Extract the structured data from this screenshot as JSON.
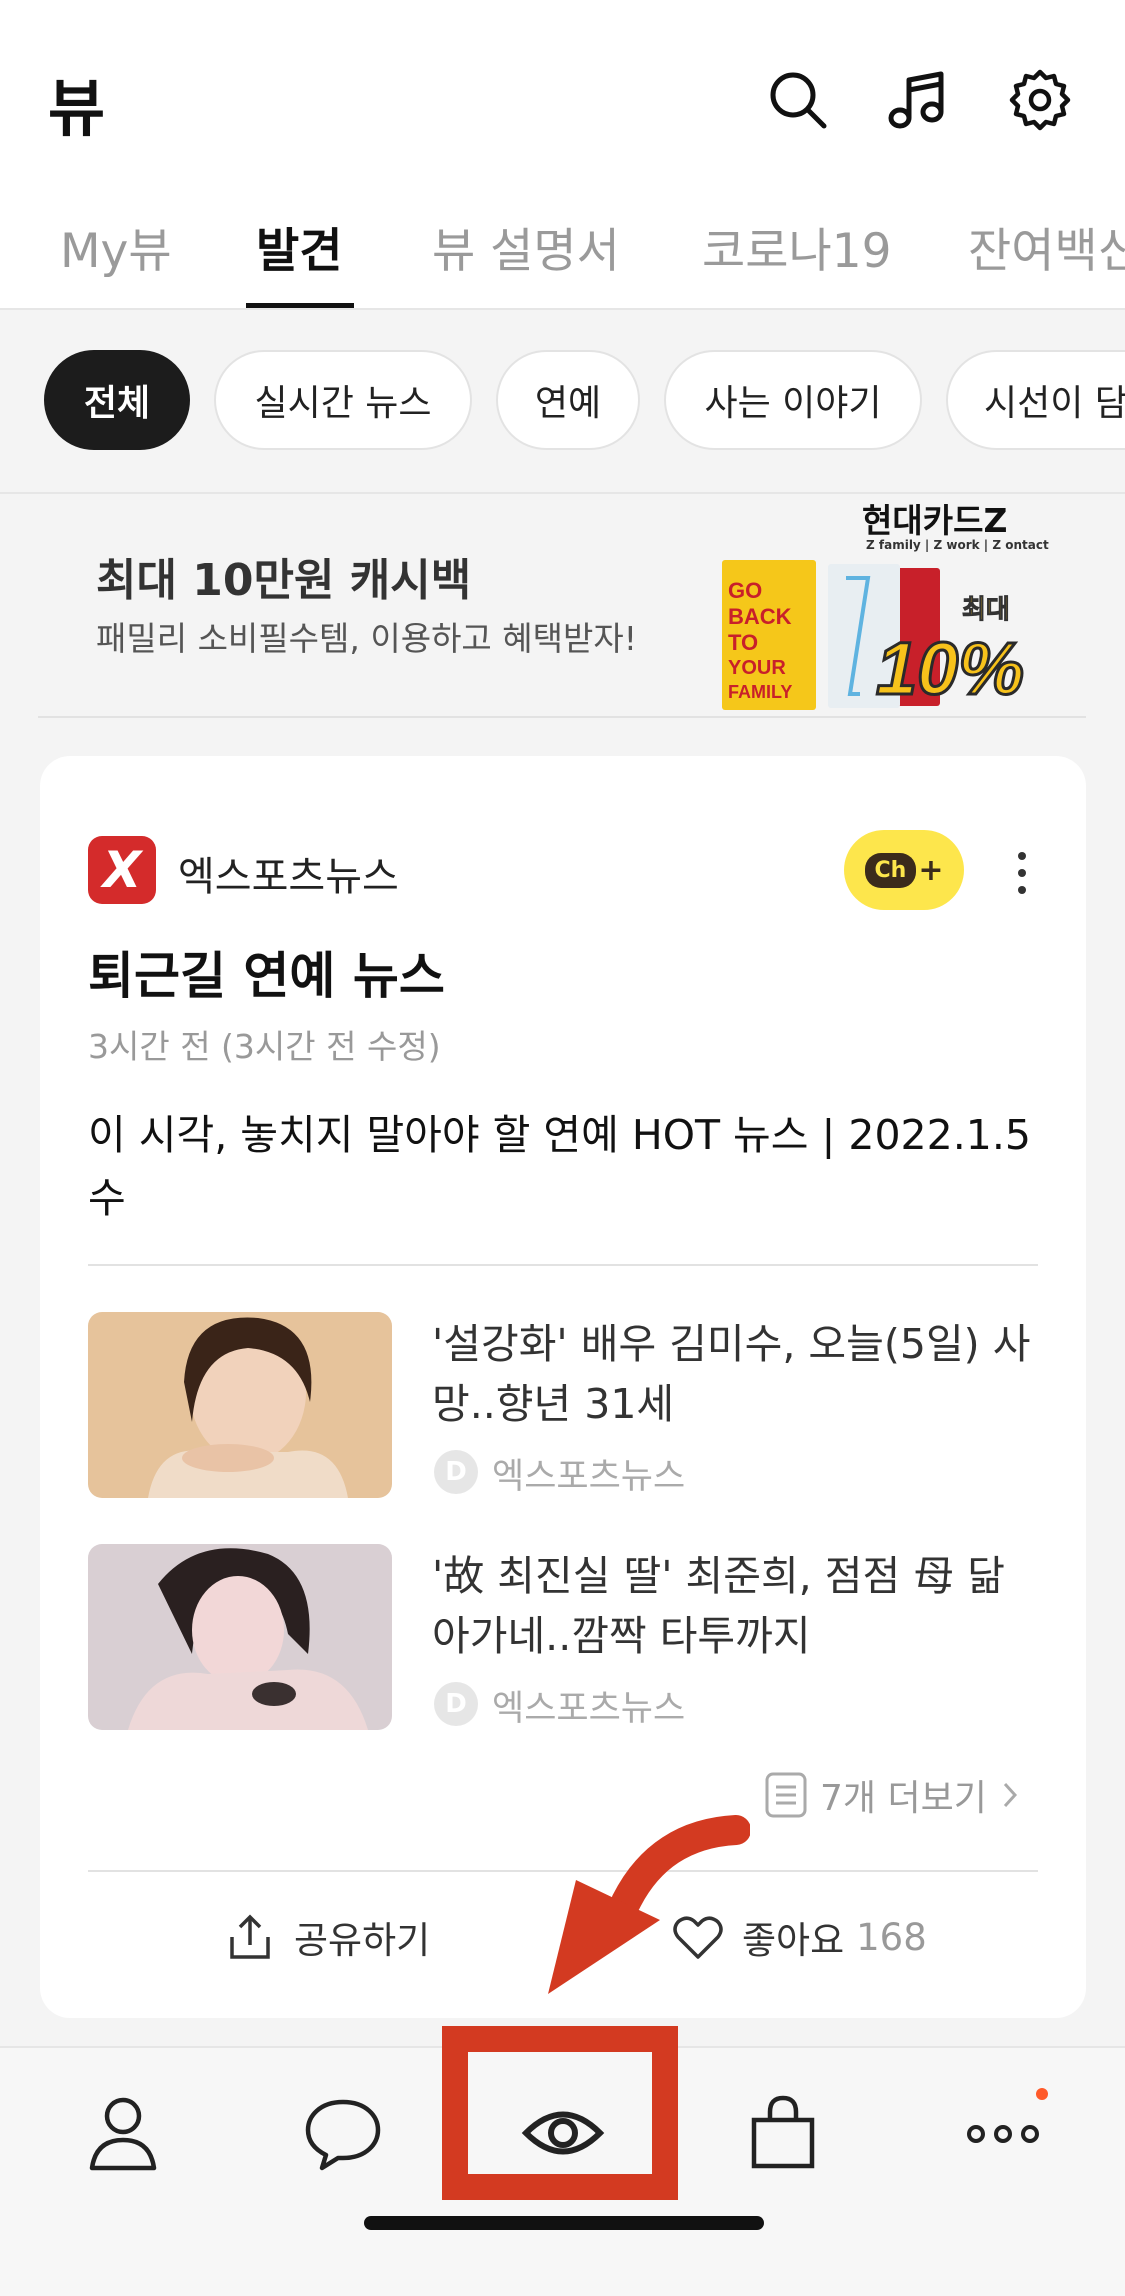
{
  "header": {
    "title": "뷰",
    "icons": [
      "search-icon",
      "music-icon",
      "settings-icon"
    ]
  },
  "tabs": [
    {
      "label": "My뷰",
      "active": false
    },
    {
      "label": "발견",
      "active": true
    },
    {
      "label": "뷰 설명서",
      "active": false
    },
    {
      "label": "코로나19",
      "active": false
    },
    {
      "label": "잔여백신",
      "active": false
    }
  ],
  "chips": [
    {
      "label": "전체",
      "active": true
    },
    {
      "label": "실시간 뉴스",
      "active": false
    },
    {
      "label": "연예",
      "active": false
    },
    {
      "label": "사는 이야기",
      "active": false
    },
    {
      "label": "시선이 담",
      "active": false
    }
  ],
  "ad": {
    "title": "최대 10만원 캐시백",
    "subtitle": "패밀리 소비필수템, 이용하고 혜택받자!",
    "brand": "현대카드Z",
    "brand_sub": "Z family | Z work | Z ontact",
    "card_text": [
      "GO",
      "BACK",
      "TO",
      "YOUR",
      "FAMILY"
    ],
    "badge_top": "최대",
    "badge_main": "10%",
    "colors": {
      "yellow_card": "#f5c71a",
      "red_card": "#c8202a",
      "badge": "#f7c21b"
    }
  },
  "card": {
    "publisher": "엑스포츠뉴스",
    "publisher_logo": "X",
    "channel_button": {
      "label": "Ch",
      "plus": "+"
    },
    "title": "퇴근길 연예 뉴스",
    "time": "3시간 전 (3시간 전 수정)",
    "description": "이 시각, 놓치지 말아야 할 연예 HOT 뉴스 | 2022.1.5 수",
    "news": [
      {
        "headline": "'설강화' 배우 김미수, 오늘(5일) 사망..향년 31세",
        "source": "엑스포츠뉴스",
        "source_icon": "D"
      },
      {
        "headline": "'故 최진실 딸' 최준희, 점점 母 닮아가네..깜짝 타투까지",
        "source": "엑스포츠뉴스",
        "source_icon": "D"
      }
    ],
    "more_label": "7개 더보기",
    "share_label": "공유하기",
    "like_label": "좋아요",
    "like_count": "168"
  },
  "bottom_nav": [
    {
      "icon": "profile-icon"
    },
    {
      "icon": "chat-icon"
    },
    {
      "icon": "view-icon",
      "highlighted": true
    },
    {
      "icon": "shopping-bag-icon"
    },
    {
      "icon": "more-icon",
      "badge": true
    }
  ],
  "colors": {
    "highlight": "#d33a21",
    "kakao_yellow": "#fde64c",
    "publisher_red": "#d42b2b",
    "notification": "#ff5a2a"
  }
}
